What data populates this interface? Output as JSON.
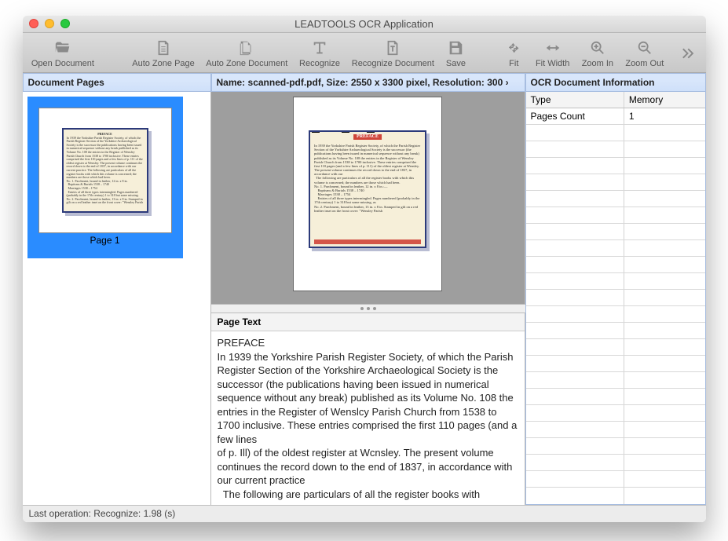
{
  "window": {
    "title": "LEADTOOLS OCR Application"
  },
  "toolbar": {
    "open_document": "Open Document",
    "auto_zone_page": "Auto Zone Page",
    "auto_zone_document": "Auto Zone Document",
    "recognize": "Recognize",
    "recognize_document": "Recognize Document",
    "save": "Save",
    "fit": "Fit",
    "fit_width": "Fit Width",
    "zoom_in": "Zoom In",
    "zoom_out": "Zoom Out"
  },
  "panels": {
    "document_pages": "Document Pages",
    "center_header": "Name: scanned-pdf.pdf, Size: 2550 x 3300 pixel, Resolution: 300 ›",
    "ocr_info": "OCR Document Information",
    "page_text": "Page Text"
  },
  "thumb": {
    "label": "Page 1"
  },
  "ocr_table": {
    "col1": "Type",
    "col2": "Memory",
    "r1c1": "Pages Count",
    "r1c2": "1"
  },
  "page_text_body": "PREFACE\nIn 1939 the Yorkshire Parish Register Society, of which the Parish Register Section of the Yorkshire Archaeological Society is the successor (the publications having been issued in numerical sequence without any break) published as its Volume No. 108 the entries in the Register of Wenslcy Parish Church from 1538 to 1700 inclusive. These entries comprised the first 110 pages (and a few lines\nof p. Ill) of the oldest register at Wcnsley. The present volume continues the record down to the end of 1837, in accordance with our current practice\n  The following are particulars of all the register books with",
  "status": "Last operation: Recognize: 1.98 (s)"
}
